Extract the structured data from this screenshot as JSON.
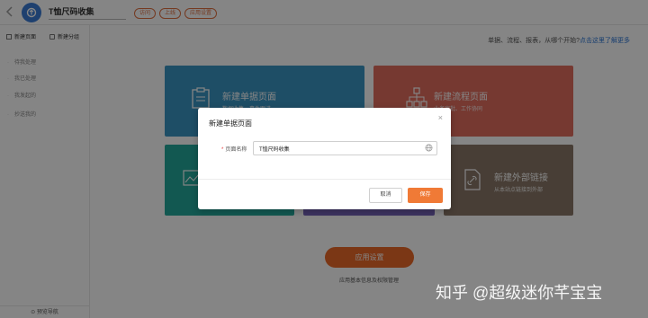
{
  "header": {
    "app_name": "T恤尺码收集",
    "tags": [
      "访问",
      "上线",
      "应用设置"
    ],
    "colors": {
      "accent": "#ec6a2a",
      "logo": "#3a7bd5"
    }
  },
  "sidebar": {
    "new_page": "新建页面",
    "new_group": "新建分组",
    "items": [
      "待我处理",
      "我已处理",
      "我发起的",
      "抄送我的"
    ],
    "bottom": "预览导航"
  },
  "main": {
    "hint_text": "单据、流程、报表，从哪个开始?",
    "hint_link": "点击这里了解更多",
    "cards": [
      {
        "title": "新建单据页面",
        "desc": "数据收集、事件跟进",
        "color": "#3b96c4",
        "icon": "form-icon"
      },
      {
        "title": "新建流程页面",
        "desc": "业务审批、工作协同",
        "color": "#e26d5e",
        "icon": "flow-icon"
      },
      {
        "title": "",
        "desc": "",
        "color": "#23a99c",
        "icon": "report-icon"
      },
      {
        "title": "",
        "desc": "",
        "color": "#7662b8",
        "icon": ""
      },
      {
        "title": "新建外部链接",
        "desc": "从本站点链接到外部",
        "color": "#8a7869",
        "icon": "link-icon"
      }
    ],
    "settings_button": "应用设置",
    "settings_sub": "应用基本信息及权限管理"
  },
  "dialog": {
    "title": "新建单据页面",
    "field_label": "页面名称",
    "field_value": "T恤尺码收集",
    "cancel": "取消",
    "save": "保存"
  },
  "watermark": "知乎 @超级迷你芊宝宝"
}
